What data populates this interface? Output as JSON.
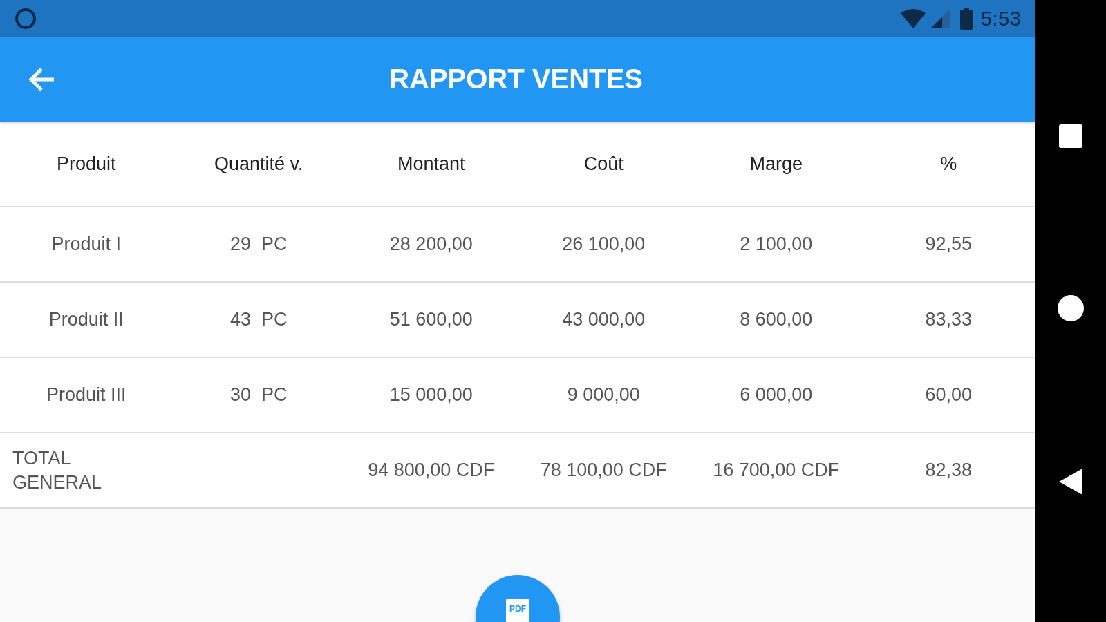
{
  "status_bar": {
    "time": "5:53"
  },
  "app_bar": {
    "title": "RAPPORT VENTES"
  },
  "table": {
    "columns": [
      "Produit",
      "Quantité v.",
      "Montant",
      "Coût",
      "Marge",
      "%"
    ],
    "rows": [
      {
        "kind": "item",
        "cells": [
          "Produit I",
          "29  PC",
          "28 200,00",
          "26 100,00",
          "2 100,00",
          "92,55"
        ]
      },
      {
        "kind": "item",
        "cells": [
          "Produit II",
          "43  PC",
          "51 600,00",
          "43 000,00",
          "8 600,00",
          "83,33"
        ]
      },
      {
        "kind": "item",
        "cells": [
          "Produit III",
          "30  PC",
          "15 000,00",
          "9 000,00",
          "6 000,00",
          "60,00"
        ]
      },
      {
        "kind": "total",
        "cells": [
          "TOTAL GENERAL",
          "",
          "94 800,00 CDF",
          "78 100,00 CDF",
          "16 700,00 CDF",
          "82,38"
        ]
      }
    ]
  },
  "fab": {
    "label": "PDF"
  }
}
